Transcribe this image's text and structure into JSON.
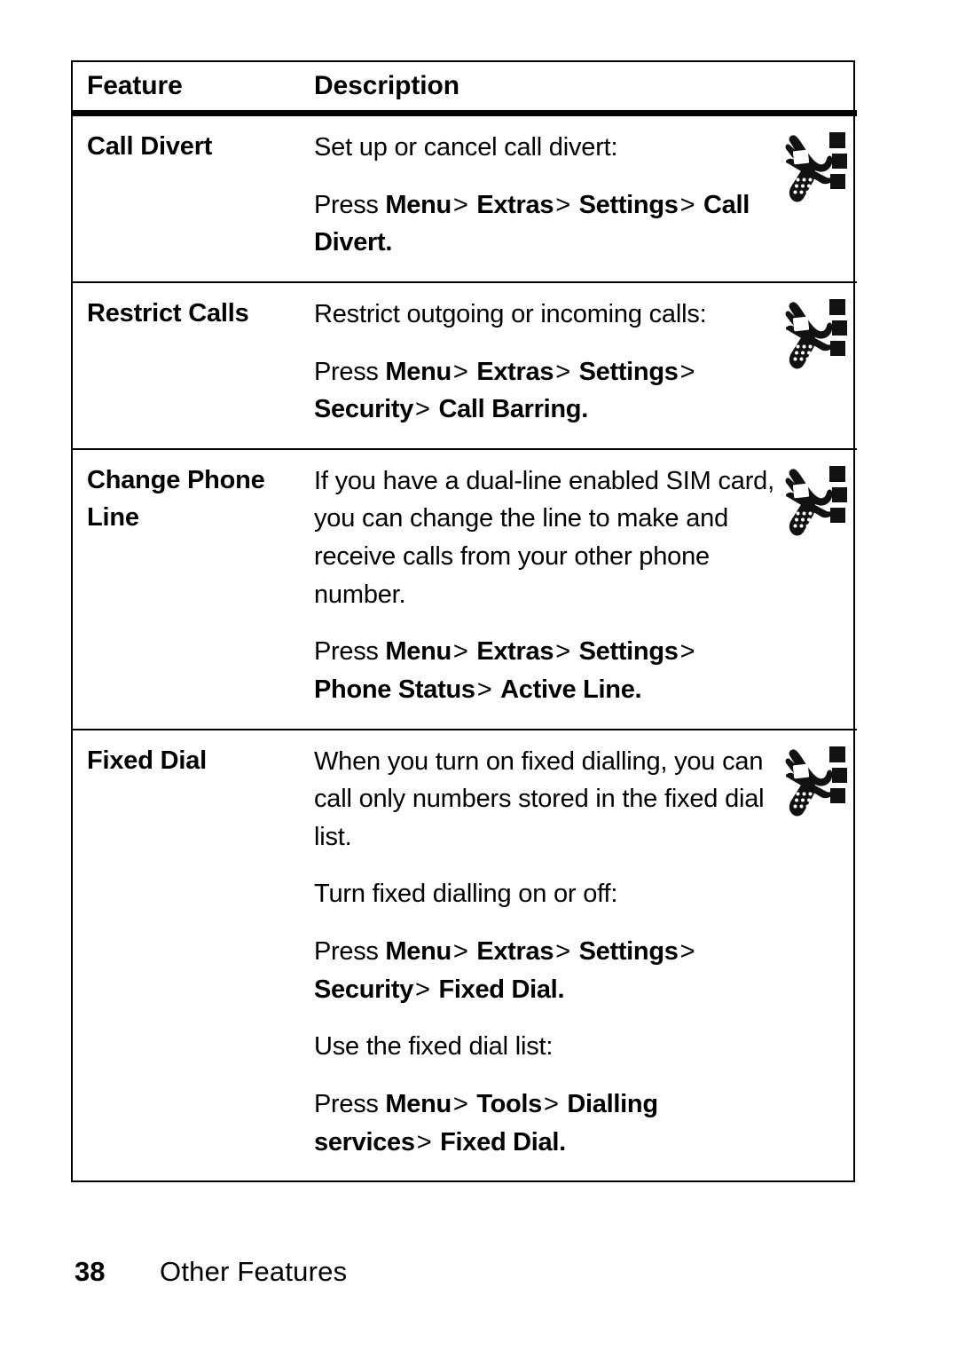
{
  "document": {
    "page_number": "38",
    "section_name": "Other Features"
  },
  "table": {
    "headers": {
      "feature": "Feature",
      "description": "Description"
    },
    "rows": [
      {
        "feature": "Call Divert",
        "icon": "flip-phone-signal-icon",
        "paragraphs": [
          {
            "type": "plain",
            "text": "Set up or cancel call divert:"
          },
          {
            "type": "path",
            "lead": "Press ",
            "tokens": [
              "Menu",
              "Extras",
              "Settings",
              "Call Divert"
            ],
            "trail": "."
          }
        ]
      },
      {
        "feature": "Restrict Calls",
        "icon": "flip-phone-signal-icon",
        "paragraphs": [
          {
            "type": "plain",
            "text": "Restrict outgoing or incoming calls:"
          },
          {
            "type": "path",
            "lead": "Press ",
            "tokens": [
              "Menu",
              "Extras",
              "Settings",
              "Security",
              "Call Barring"
            ],
            "trail": "."
          }
        ]
      },
      {
        "feature": "Change Phone Line",
        "icon": "flip-phone-signal-icon",
        "paragraphs": [
          {
            "type": "plain",
            "text": "If you have a dual-line enabled SIM card, you can change the line to make and receive calls from your other phone number."
          },
          {
            "type": "path",
            "lead": "Press ",
            "tokens": [
              "Menu",
              "Extras",
              "Settings",
              "Phone Status",
              "Active Line"
            ],
            "trail": "."
          }
        ]
      },
      {
        "feature": "Fixed Dial",
        "icon": "flip-phone-signal-icon",
        "paragraphs": [
          {
            "type": "plain",
            "text": "When you turn on fixed dialling, you can call only numbers stored in the fixed dial list."
          },
          {
            "type": "plain",
            "text": "Turn fixed dialling on or off:"
          },
          {
            "type": "path",
            "lead": "Press ",
            "tokens": [
              "Menu",
              "Extras",
              "Settings",
              "Security",
              "Fixed Dial"
            ],
            "trail": "."
          },
          {
            "type": "plain",
            "text": "Use the fixed dial list:"
          },
          {
            "type": "path",
            "lead": "Press ",
            "tokens": [
              "Menu",
              "Tools",
              "Dialling services",
              "Fixed Dial"
            ],
            "trail": "."
          }
        ]
      }
    ]
  },
  "colors": {
    "text": "#000000",
    "background": "#ffffff",
    "border": "#000000"
  }
}
